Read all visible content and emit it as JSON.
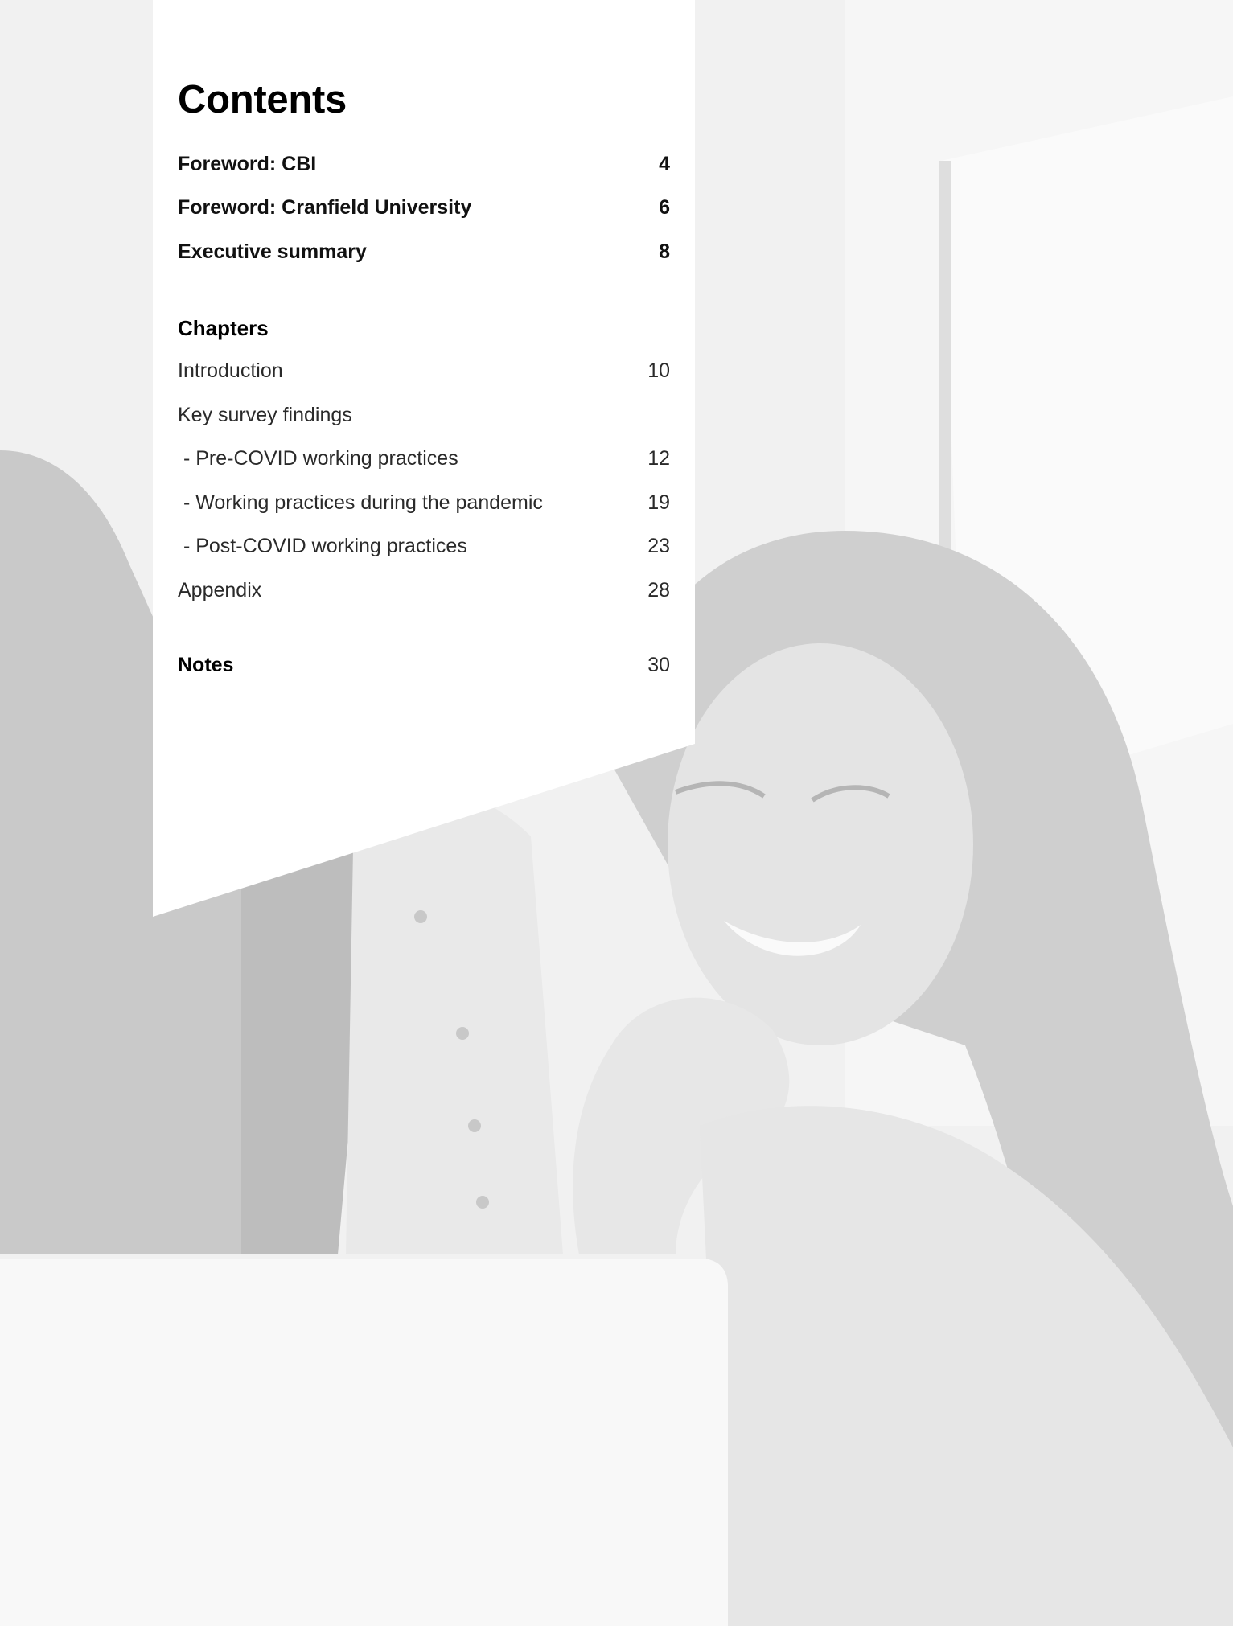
{
  "contents": {
    "title": "Contents",
    "front_matter": [
      {
        "label": "Foreword: CBI",
        "page": "4"
      },
      {
        "label": "Foreword: Cranfield University",
        "page": "6"
      },
      {
        "label": "Executive summary",
        "page": "8"
      }
    ],
    "chapters_heading": "Chapters",
    "chapters": [
      {
        "label": "Introduction",
        "page": "10"
      },
      {
        "label": "Key survey findings",
        "page": ""
      },
      {
        "label": " - Pre-COVID working practices",
        "page": "12"
      },
      {
        "label": " - Working practices during the pandemic",
        "page": "19"
      },
      {
        "label": " - Post-COVID working practices",
        "page": "23"
      },
      {
        "label": "Appendix",
        "page": "28"
      }
    ],
    "notes": {
      "label": "Notes",
      "page": "30"
    }
  },
  "colors": {
    "panel": "#ffffff",
    "background": "#f3f3f3",
    "text": "#000000"
  }
}
